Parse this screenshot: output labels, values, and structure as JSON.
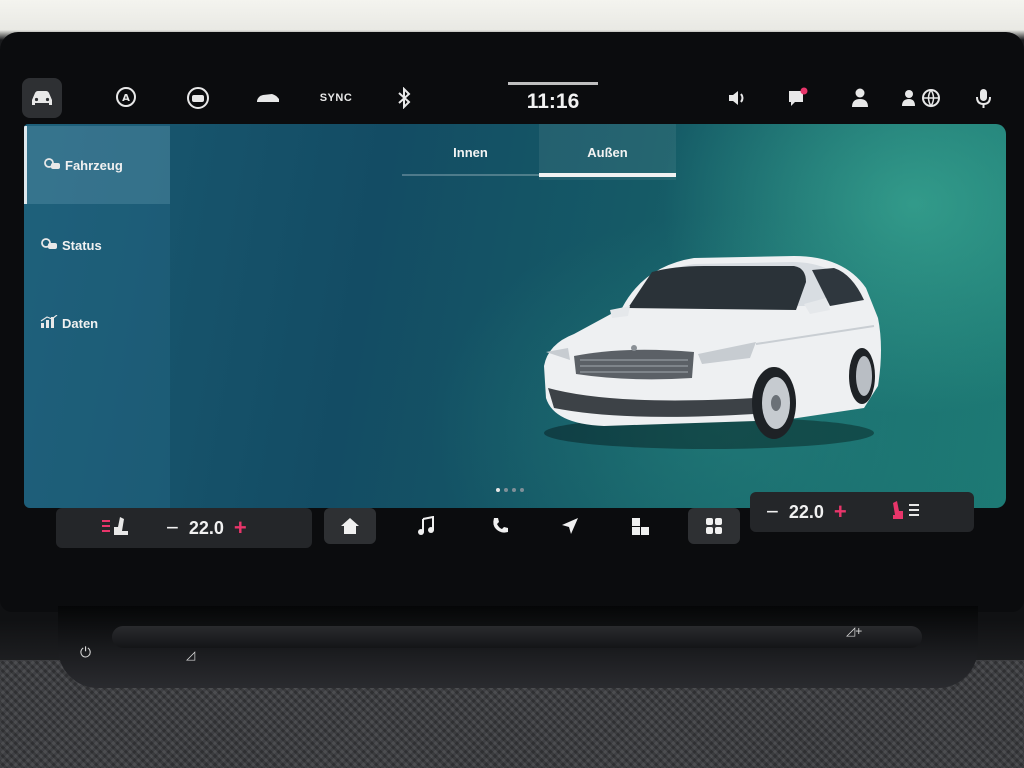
{
  "status_bar": {
    "icons": [
      "car-icon",
      "auto-hold-icon",
      "driver-assist-icon",
      "car-side-icon",
      "bluetooth-icon",
      "speaker-icon",
      "notification-icon",
      "user-icon",
      "connected-services-icon",
      "voice-assistant-icon"
    ],
    "sync_label": "SYNC",
    "time": "11:16"
  },
  "sidebar": {
    "items": [
      {
        "label": "Fahrzeug",
        "icon": "vehicle-icon"
      },
      {
        "label": "Status",
        "icon": "status-icon"
      },
      {
        "label": "Daten",
        "icon": "data-icon"
      }
    ]
  },
  "tabs": [
    {
      "label": "Innen"
    },
    {
      "label": "Außen"
    }
  ],
  "climate": {
    "left_temp": "22.0",
    "right_temp": "22.0",
    "minus": "−",
    "plus": "+"
  },
  "dock": {
    "icons": [
      "home-icon",
      "music-icon",
      "phone-icon",
      "navigation-icon",
      "apps-icon",
      "menu-grid-icon"
    ]
  },
  "colors": {
    "accent": "#e8356a",
    "screen_bg": "#155a66"
  },
  "pager": {
    "count": 4,
    "active": 0
  }
}
